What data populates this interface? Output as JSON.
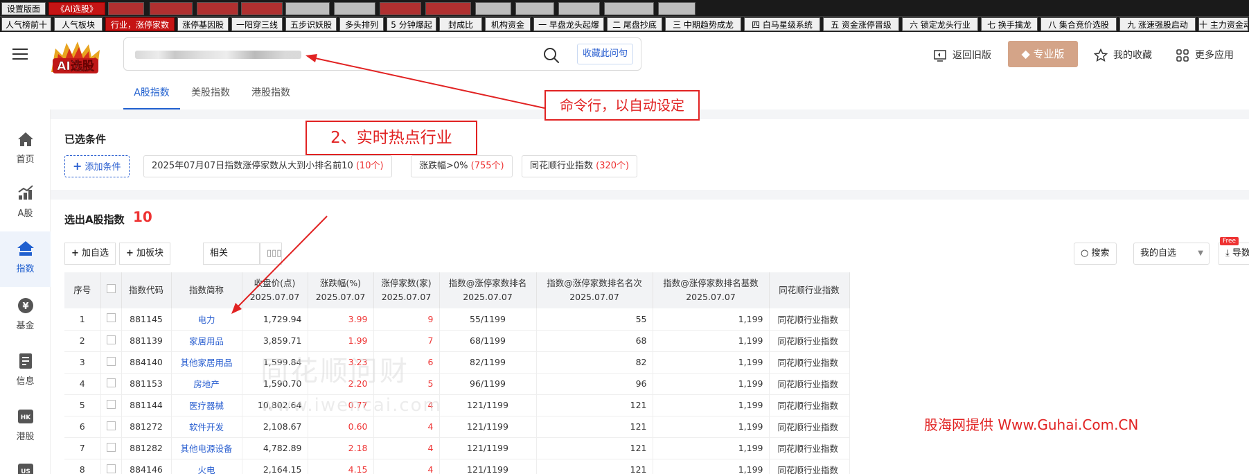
{
  "top_tabs": {
    "row1": [
      "设置版面",
      "《AI选股》"
    ],
    "row2": [
      "人气榜前十",
      "人气板块",
      "行业，涨停家数",
      "涨停基因股",
      "一阳穿三线",
      "五步识妖股",
      "多头排列",
      "5 分钟爆起",
      "封成比",
      "机构资金",
      "一 早盘龙头起爆",
      "二 尾盘抄底",
      "三 中期趋势成龙",
      "四 白马星级系统",
      "五 资金涨停晋级",
      "六 锁定龙头行业",
      "七 换手擒龙",
      "八 集合竞价选股",
      "九 涨速强股启动",
      "十 主力资金动向"
    ]
  },
  "header": {
    "logo_text": "AI选股",
    "search_favorite": "收藏此问句",
    "back_old": "返回旧版",
    "pro": "专业版",
    "my_favorites": "我的收藏",
    "more_apps": "更多应用"
  },
  "market_tabs": [
    "A股指数",
    "美股指数",
    "港股指数"
  ],
  "sidebar": [
    {
      "label": "首页",
      "icon": "home-icon"
    },
    {
      "label": "A股",
      "icon": "stock-chart-icon"
    },
    {
      "label": "指数",
      "icon": "index-icon"
    },
    {
      "label": "基金",
      "icon": "yen-icon"
    },
    {
      "label": "信息",
      "icon": "document-icon"
    },
    {
      "label": "港股",
      "icon": "hk-icon"
    },
    {
      "label": "US",
      "icon": "us-icon"
    }
  ],
  "conditions": {
    "title": "已选条件",
    "add_label": "添加条件",
    "chips": [
      {
        "text": "2025年07月07日指数涨停家数从大到小排名前10",
        "count": "(10个)"
      },
      {
        "text": "涨跌幅>0%",
        "count": "(755个)"
      },
      {
        "text": "同花顺行业指数",
        "count": "(320个)"
      }
    ]
  },
  "result": {
    "title": "选出A股指数",
    "count": "10",
    "add_watch": "加自选",
    "add_sector": "加板块",
    "sort_label": "相关",
    "search": "搜索",
    "my_watch": "我的自选",
    "free_badge": "Free",
    "export": "导数"
  },
  "table": {
    "headers": [
      {
        "l1": "序号",
        "l2": ""
      },
      {
        "l1": "",
        "l2": ""
      },
      {
        "l1": "指数代码",
        "l2": ""
      },
      {
        "l1": "指数简称",
        "l2": ""
      },
      {
        "l1": "收盘价(点)",
        "l2": "2025.07.07"
      },
      {
        "l1": "涨跌幅(%)",
        "l2": "2025.07.07"
      },
      {
        "l1": "涨停家数(家)",
        "l2": "2025.07.07"
      },
      {
        "l1": "指数@涨停家数排名",
        "l2": "2025.07.07"
      },
      {
        "l1": "指数@涨停家数排名名次",
        "l2": "2025.07.07"
      },
      {
        "l1": "指数@涨停家数排名基数",
        "l2": "2025.07.07"
      },
      {
        "l1": "同花顺行业指数",
        "l2": ""
      }
    ],
    "rows": [
      [
        "1",
        "881145",
        "电力",
        "1,729.94",
        "3.99",
        "9",
        "55/1199",
        "55",
        "1,199",
        "同花顺行业指数"
      ],
      [
        "2",
        "881139",
        "家居用品",
        "3,859.71",
        "1.99",
        "7",
        "68/1199",
        "68",
        "1,199",
        "同花顺行业指数"
      ],
      [
        "3",
        "884140",
        "其他家居用品",
        "1,599.84",
        "3.23",
        "6",
        "82/1199",
        "82",
        "1,199",
        "同花顺行业指数"
      ],
      [
        "4",
        "881153",
        "房地产",
        "1,590.70",
        "2.20",
        "5",
        "96/1199",
        "96",
        "1,199",
        "同花顺行业指数"
      ],
      [
        "5",
        "881144",
        "医疗器械",
        "10,802.64",
        "0.77",
        "4",
        "121/1199",
        "121",
        "1,199",
        "同花顺行业指数"
      ],
      [
        "6",
        "881272",
        "软件开发",
        "2,108.67",
        "0.60",
        "4",
        "121/1199",
        "121",
        "1,199",
        "同花顺行业指数"
      ],
      [
        "7",
        "881282",
        "其他电源设备",
        "4,782.89",
        "2.18",
        "4",
        "121/1199",
        "121",
        "1,199",
        "同花顺行业指数"
      ],
      [
        "8",
        "884146",
        "火电",
        "2,164.15",
        "4.15",
        "4",
        "121/1199",
        "121",
        "1,199",
        "同花顺行业指数"
      ]
    ]
  },
  "watermark": {
    "cn": "同花顺问财",
    "en": "www.iwencai.com"
  },
  "annotations": {
    "cmd": "命令行，以自动设定",
    "hot": "2、实时热点行业",
    "guhai": "股海网提供 Www.Guhai.Com.CN"
  },
  "colors": {
    "accent": "#1f5fcf",
    "red": "#e12222",
    "pro": "#d4a488"
  }
}
